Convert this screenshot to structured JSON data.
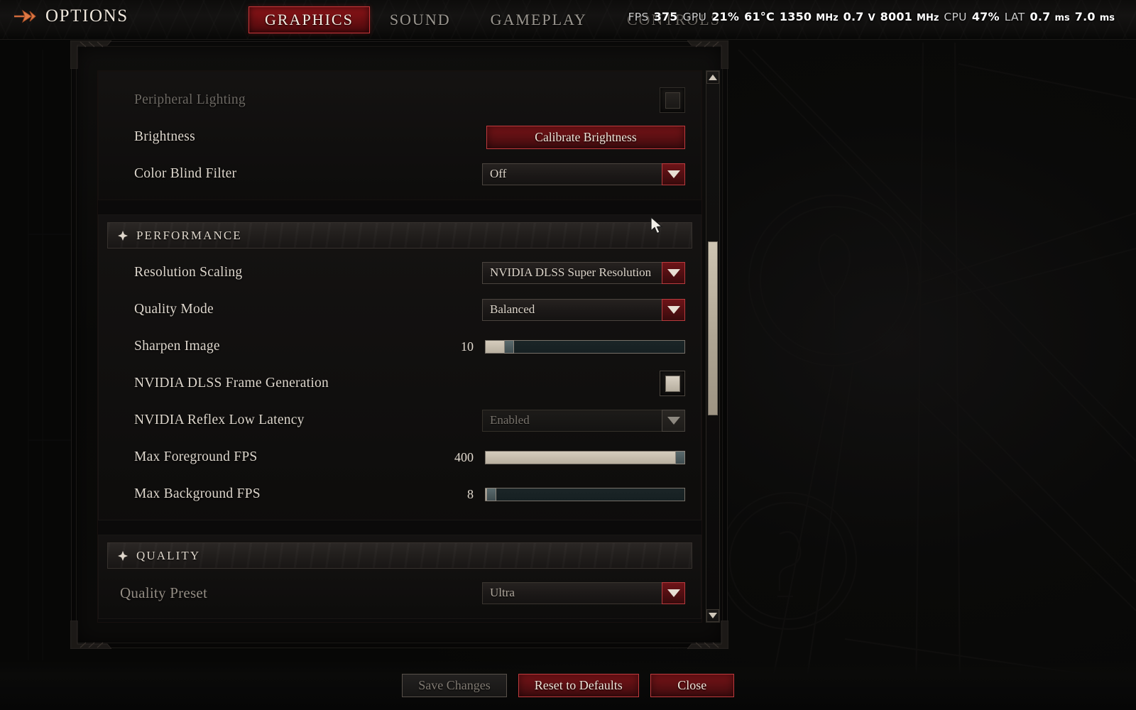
{
  "topbar": {
    "arrow_icon": "double-arrow-icon",
    "title": "OPTIONS",
    "tabs": [
      {
        "label": "GRAPHICS",
        "active": true
      },
      {
        "label": "SOUND",
        "active": false
      },
      {
        "label": "GAMEPLAY",
        "active": false
      },
      {
        "label": "CONTROLS",
        "active": false
      }
    ]
  },
  "fps_overlay": {
    "fps_label": "FPS",
    "fps_value": "375",
    "gpu_label": "GPU",
    "gpu_usage": "21%",
    "gpu_temp": "61°C",
    "gpu_clock": "1350",
    "gpu_clock_unit": "MHz",
    "gpu_voltage": "0.7",
    "gpu_voltage_unit": "V",
    "mem_clock": "8001",
    "mem_clock_unit": "MHz",
    "cpu_label": "CPU",
    "cpu_usage": "47%",
    "lat_label": "LAT",
    "lat_render": "0.7",
    "lat_render_unit": "ms",
    "lat_total": "7.0",
    "lat_total_unit": "ms"
  },
  "groups": [
    {
      "id": "display",
      "header": null,
      "rows": [
        {
          "name": "peripheral-lighting",
          "label": "Peripheral Lighting",
          "type": "checkbox",
          "checked": false,
          "disabled": true
        },
        {
          "name": "brightness",
          "label": "Brightness",
          "type": "button",
          "button_label": "Calibrate Brightness",
          "disabled": false
        },
        {
          "name": "color-blind-filter",
          "label": "Color Blind Filter",
          "type": "dropdown",
          "value": "Off",
          "disabled": false
        }
      ]
    },
    {
      "id": "performance",
      "header": "PERFORMANCE",
      "rows": [
        {
          "name": "resolution-scaling",
          "label": "Resolution Scaling",
          "type": "dropdown",
          "value": "NVIDIA DLSS Super Resolution",
          "disabled": false
        },
        {
          "name": "quality-mode",
          "label": "Quality Mode",
          "type": "dropdown",
          "value": "Balanced",
          "disabled": false
        },
        {
          "name": "sharpen-image",
          "label": "Sharpen Image",
          "type": "slider",
          "value": "10",
          "percent": 10,
          "disabled": false
        },
        {
          "name": "nvidia-dlss-frame-generation",
          "label": "NVIDIA DLSS Frame Generation",
          "type": "checkbox",
          "checked": true,
          "disabled": false
        },
        {
          "name": "nvidia-reflex-low-latency",
          "label": "NVIDIA Reflex Low Latency",
          "type": "dropdown",
          "value": "Enabled",
          "disabled": true
        },
        {
          "name": "max-foreground-fps",
          "label": "Max Foreground FPS",
          "type": "slider",
          "value": "400",
          "percent": 97,
          "disabled": false
        },
        {
          "name": "max-background-fps",
          "label": "Max Background FPS",
          "type": "slider",
          "value": "8",
          "percent": 1,
          "disabled": false
        }
      ]
    },
    {
      "id": "quality",
      "header": "QUALITY",
      "rows": [
        {
          "name": "quality-preset",
          "label": "Quality Preset",
          "type": "dropdown",
          "value": "Ultra",
          "disabled": true
        }
      ]
    }
  ],
  "scrollbar": {
    "up_icon": "chevron-up-icon",
    "down_icon": "chevron-down-icon",
    "thumb_top_pct": 31,
    "thumb_height_pct": 31
  },
  "footer": {
    "buttons": [
      {
        "name": "save-changes-button",
        "label": "Save Changes",
        "style": "disabled"
      },
      {
        "name": "reset-to-defaults-button",
        "label": "Reset to Defaults",
        "style": "red"
      },
      {
        "name": "close-button",
        "label": "Close",
        "style": "red"
      }
    ]
  },
  "colors": {
    "accent_red": "#7c1418",
    "accent_red_border": "#bf3a3d",
    "text_primary": "#ded7cd",
    "text_dim": "#6c6862",
    "slider_fill": "#d5ccbd",
    "background": "#070706"
  }
}
